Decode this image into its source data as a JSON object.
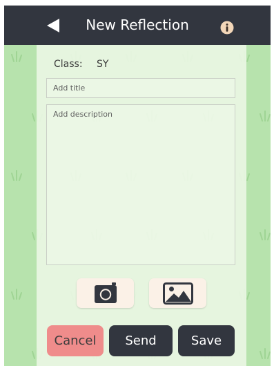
{
  "header": {
    "title": "New Reflection",
    "back_icon": "back-arrow-icon",
    "info_icon": "info-icon"
  },
  "form": {
    "class_label": "Class:",
    "class_value": "SY",
    "title_placeholder": "Add title",
    "description_placeholder": "Add description"
  },
  "media": {
    "camera_icon": "camera-icon",
    "gallery_icon": "image-icon"
  },
  "actions": {
    "cancel_label": "Cancel",
    "send_label": "Send",
    "save_label": "Save"
  },
  "colors": {
    "nav_bar": "#32363f",
    "background": "#b7e3ad",
    "panel": "#e9f6e3",
    "cancel": "#ef8c8b",
    "media_button": "#fbf1e7",
    "info_icon": "#f3d7b9"
  }
}
